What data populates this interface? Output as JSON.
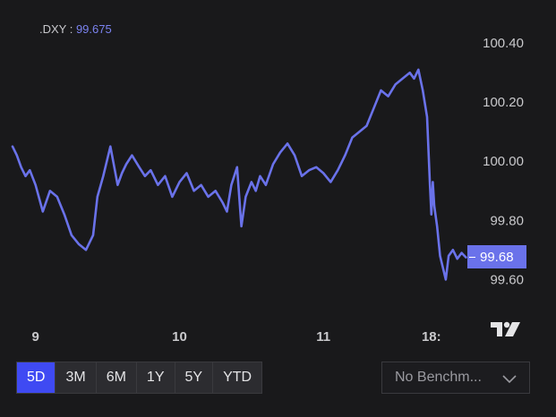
{
  "header": {
    "ticker": ".DXY",
    "separator": " : ",
    "value": "99.675"
  },
  "price_tag": "99.68",
  "range_buttons": [
    {
      "label": "5D",
      "active": true
    },
    {
      "label": "3M",
      "active": false
    },
    {
      "label": "6M",
      "active": false
    },
    {
      "label": "1Y",
      "active": false
    },
    {
      "label": "5Y",
      "active": false
    },
    {
      "label": "YTD",
      "active": false
    }
  ],
  "benchmark": {
    "label": "No Benchm...",
    "icon": "chevron-down-icon"
  },
  "logo": {
    "icon": "tradingview-logo-icon"
  },
  "colors": {
    "line": "#6a72ea",
    "background": "#19191b",
    "accent": "#3f4af3"
  },
  "chart_data": {
    "type": "line",
    "title": "",
    "xlabel": "",
    "ylabel": "",
    "ylim": [
      99.48,
      100.47
    ],
    "xlim": [
      8.84,
      12.0
    ],
    "yticks": [
      "100.40",
      "100.20",
      "100.00",
      "99.80",
      "99.60"
    ],
    "ytick_values": [
      100.4,
      100.2,
      100.0,
      99.8,
      99.6
    ],
    "xticks": [
      "9",
      "10",
      "11",
      "18:"
    ],
    "xtick_values": [
      9,
      10,
      11,
      11.75
    ],
    "grid": false,
    "series": [
      {
        "x": [
          8.84,
          8.87,
          8.9,
          8.93,
          8.96,
          9.0,
          9.05,
          9.1,
          9.15,
          9.2,
          9.25,
          9.3,
          9.35,
          9.4,
          9.43,
          9.47,
          9.52,
          9.57,
          9.6,
          9.63,
          9.67,
          9.72,
          9.76,
          9.8,
          9.85,
          9.9,
          9.95,
          10.0,
          10.05,
          10.1,
          10.15,
          10.2,
          10.25,
          10.3,
          10.33,
          10.36,
          10.4,
          10.43,
          10.46,
          10.5,
          10.53,
          10.56,
          10.6,
          10.65,
          10.7,
          10.75,
          10.8,
          10.85,
          10.9,
          10.95,
          11.0,
          11.05,
          11.1,
          11.15,
          11.2,
          11.25,
          11.3,
          11.35,
          11.4,
          11.45,
          11.5,
          11.55,
          11.6,
          11.63,
          11.66,
          11.69,
          11.72,
          11.74,
          11.75,
          11.76,
          11.77,
          11.79,
          11.81,
          11.83,
          11.85,
          11.87,
          11.9,
          11.93,
          11.96,
          11.99
        ],
        "y": [
          100.05,
          100.02,
          99.98,
          99.95,
          99.97,
          99.92,
          99.83,
          99.9,
          99.88,
          99.82,
          99.75,
          99.72,
          99.7,
          99.75,
          99.88,
          99.95,
          100.05,
          99.92,
          99.96,
          99.99,
          100.02,
          99.98,
          99.95,
          99.97,
          99.92,
          99.95,
          99.88,
          99.93,
          99.96,
          99.9,
          99.92,
          99.88,
          99.9,
          99.86,
          99.83,
          99.92,
          99.98,
          99.78,
          99.88,
          99.93,
          99.9,
          99.95,
          99.92,
          99.99,
          100.03,
          100.06,
          100.02,
          99.95,
          99.97,
          99.98,
          99.96,
          99.93,
          99.97,
          100.02,
          100.08,
          100.1,
          100.12,
          100.18,
          100.24,
          100.22,
          100.26,
          100.28,
          100.3,
          100.28,
          100.31,
          100.24,
          100.15,
          99.92,
          99.82,
          99.93,
          99.85,
          99.78,
          99.68,
          99.64,
          99.6,
          99.68,
          99.7,
          99.67,
          99.69,
          99.675
        ]
      }
    ]
  }
}
